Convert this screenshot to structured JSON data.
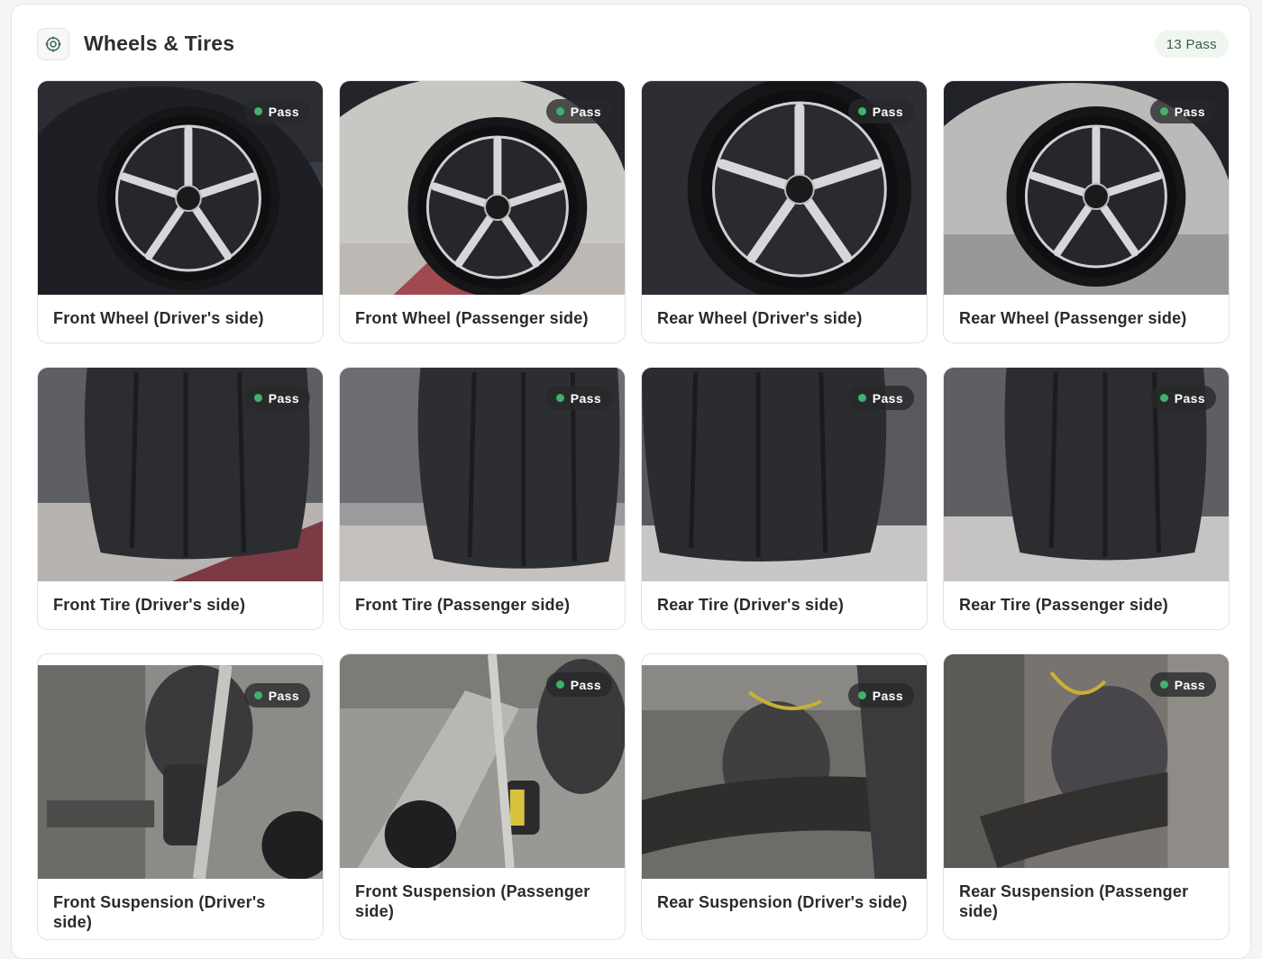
{
  "section": {
    "title": "Wheels & Tires",
    "icon": "target-icon",
    "count_badge": "13 Pass"
  },
  "status": {
    "pass_color": "#3fb36b"
  },
  "cards": [
    {
      "label": "Front Wheel (Driver's side)",
      "status": "Pass"
    },
    {
      "label": "Front Wheel (Passenger side)",
      "status": "Pass"
    },
    {
      "label": "Rear Wheel (Driver's side)",
      "status": "Pass"
    },
    {
      "label": "Rear Wheel (Passenger side)",
      "status": "Pass"
    },
    {
      "label": "Front Tire (Driver's side)",
      "status": "Pass"
    },
    {
      "label": "Front Tire (Passenger side)",
      "status": "Pass"
    },
    {
      "label": "Rear Tire (Driver's side)",
      "status": "Pass"
    },
    {
      "label": "Rear Tire (Passenger side)",
      "status": "Pass"
    },
    {
      "label": "Front Suspension (Driver's side)",
      "status": "Pass"
    },
    {
      "label": "Front Suspension (Passenger side)",
      "status": "Pass"
    },
    {
      "label": "Rear Suspension (Driver's side)",
      "status": "Pass"
    },
    {
      "label": "Rear Suspension (Passenger side)",
      "status": "Pass"
    }
  ]
}
